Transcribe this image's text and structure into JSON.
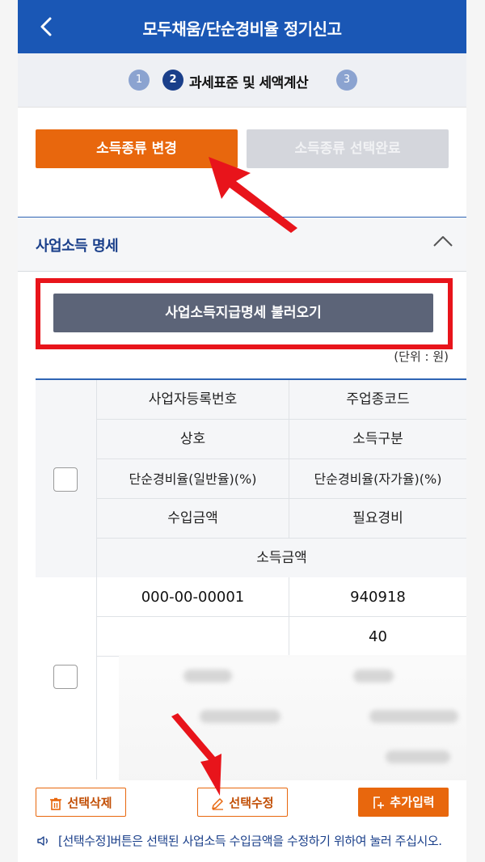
{
  "header": {
    "title": "모두채움/단순경비율 정기신고"
  },
  "steps": {
    "step1": "1",
    "step2": "2",
    "step2_label": "과세표준 및 세액계산",
    "step3": "3"
  },
  "income_type": {
    "change_label": "소득종류 변경",
    "done_label": "소득종류 선택완료"
  },
  "section": {
    "title": "사업소득 명세",
    "load_button": "사업소득지급명세 불러오기",
    "unit": "(단위 : 원)"
  },
  "table": {
    "headers": {
      "biz_reg_no": "사업자등록번호",
      "main_code": "주업종코드",
      "name": "상호",
      "income_type": "소득구분",
      "rate_general": "단순경비율(일반율)(%)",
      "rate_self": "단순경비율(자가율)(%)",
      "revenue": "수입금액",
      "expense": "필요경비",
      "income": "소득금액"
    },
    "row1": {
      "biz_reg_no": "000-00-00001",
      "main_code": "940918",
      "income_type": "40"
    }
  },
  "actions": {
    "delete_label": "선택삭제",
    "edit_label": "선택수정",
    "add_label": "추가입력"
  },
  "notice": {
    "text": "[선택수정]버튼은 선택된 사업소득 수입금액을 수정하기 위하여 눌러 주십시오."
  },
  "colors": {
    "header_blue": "#1a57b5",
    "accent_orange": "#e8670d",
    "highlight_red": "#e8141b"
  }
}
